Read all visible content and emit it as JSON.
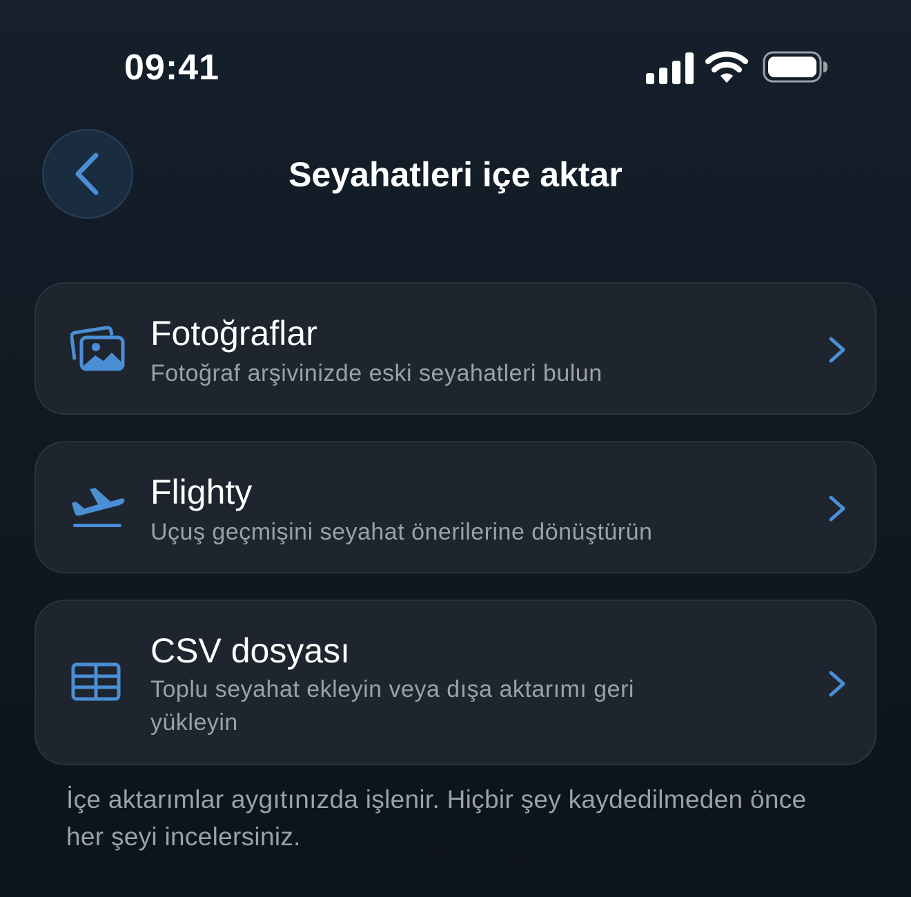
{
  "status_bar": {
    "time": "09:41"
  },
  "header": {
    "title": "Seyahatleri içe aktar"
  },
  "import_options": [
    {
      "title": "Fotoğraflar",
      "subtitle": "Fotoğraf arşivinizde eski seyahatleri bulun",
      "icon": "photos-icon"
    },
    {
      "title": "Flighty",
      "subtitle": "Uçuş geçmişini seyahat önerilerine dönüştürün",
      "icon": "airplane-takeoff-icon"
    },
    {
      "title": "CSV dosyası",
      "subtitle": "Toplu seyahat ekleyin veya dışa aktarımı geri yükleyin",
      "icon": "table-icon"
    }
  ],
  "footer": {
    "note": "İçe aktarımlar aygıtınızda işlenir. Hiçbir şey kaydedilmeden önce her şeyi incelersiniz."
  },
  "colors": {
    "accent": "#4a8fd6",
    "card_background": "#1f252e",
    "secondary_text": "#9aa1aa"
  }
}
